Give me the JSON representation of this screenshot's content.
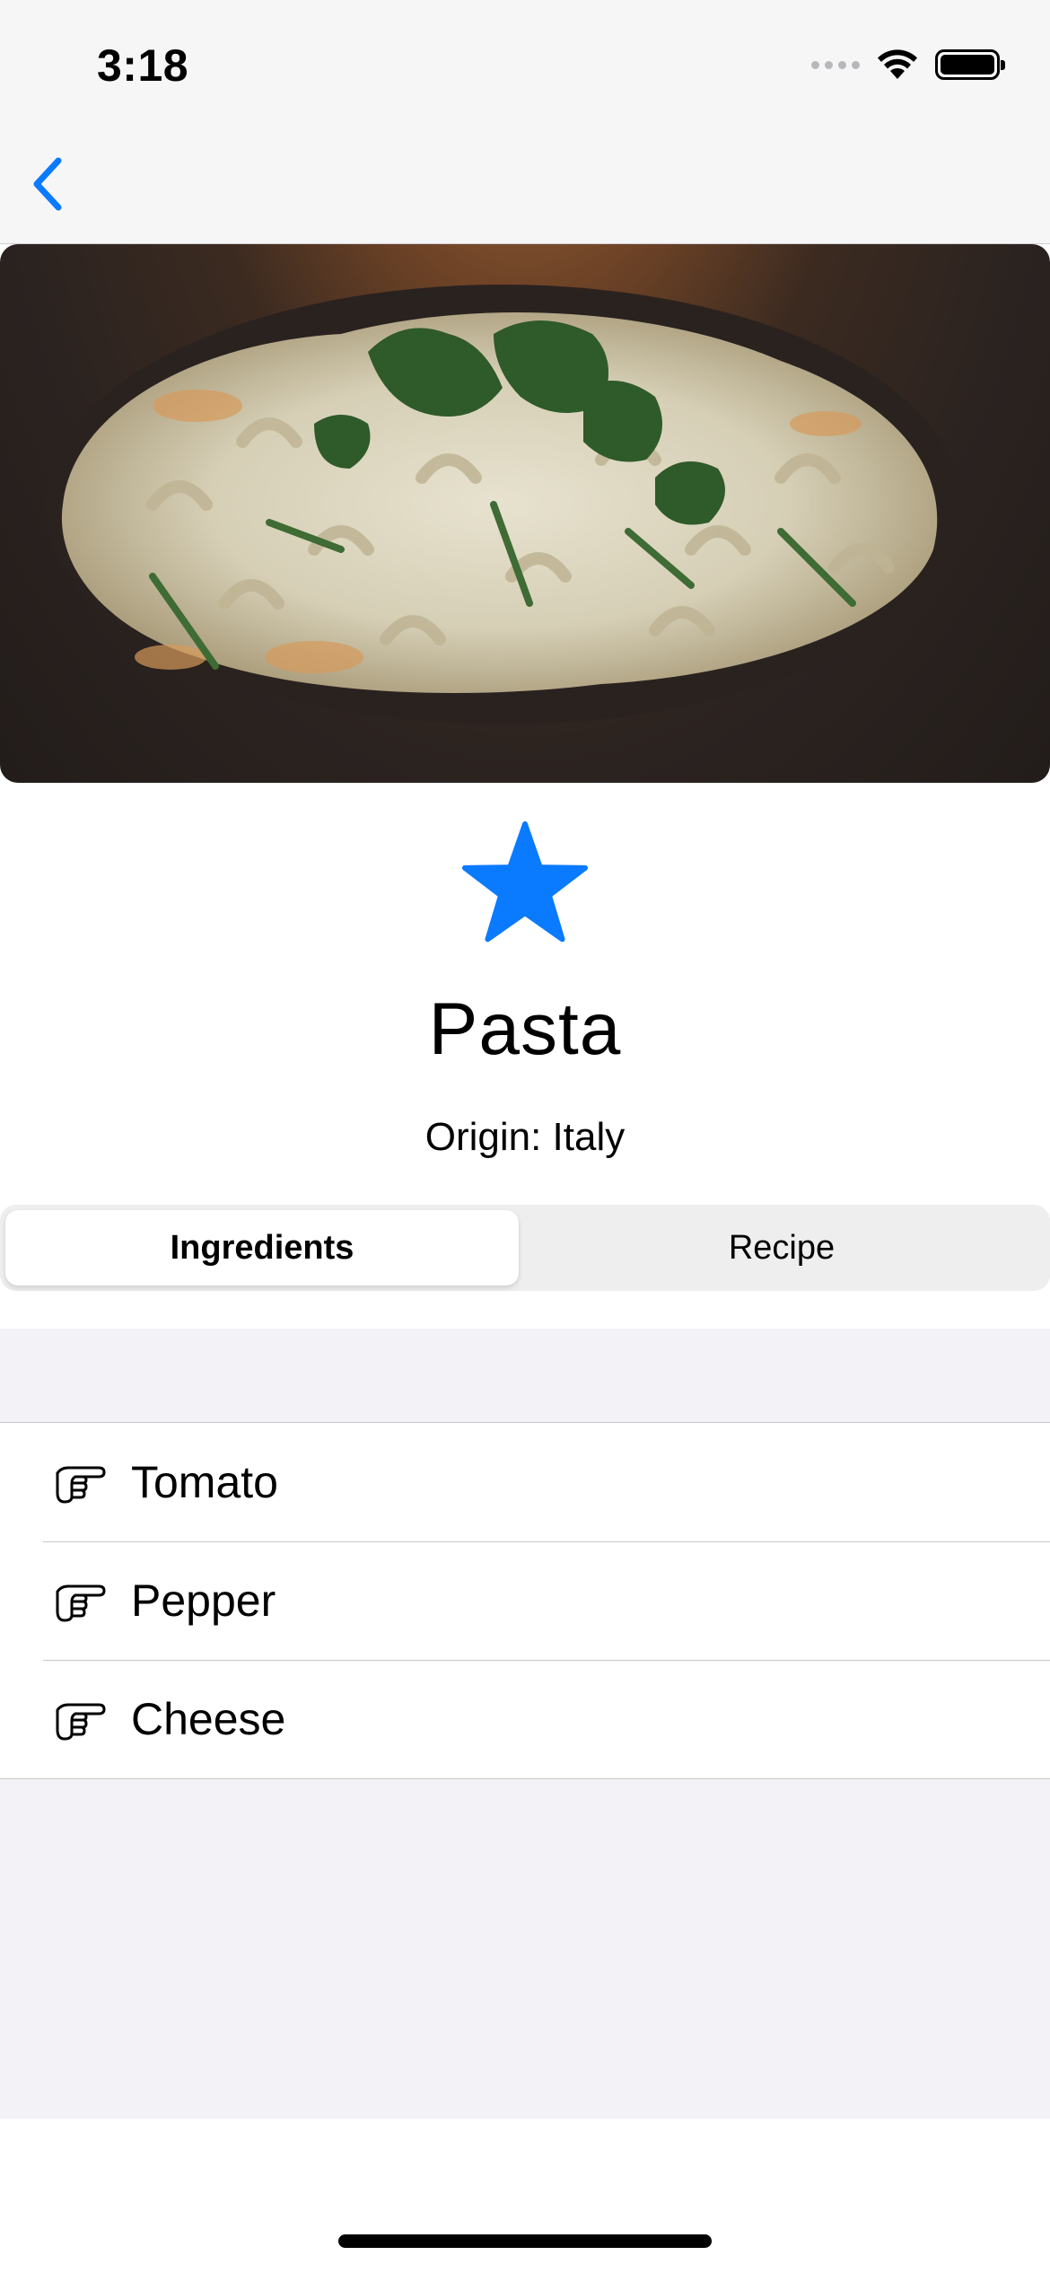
{
  "status_bar": {
    "time": "3:18"
  },
  "nav": {
    "back_icon": "chevron-left-icon"
  },
  "colors": {
    "accent": "#0a7aff",
    "grouped_background": "#f2f2f7"
  },
  "dish": {
    "image_alt": "Pasta dish",
    "favorite_icon": "star-filled-icon",
    "title": "Pasta",
    "origin": "Origin: Italy"
  },
  "segments": [
    {
      "label": "Ingredients",
      "selected": true
    },
    {
      "label": "Recipe",
      "selected": false
    }
  ],
  "ingredients": [
    {
      "icon": "hand-point-right-icon",
      "label": "Tomato"
    },
    {
      "icon": "hand-point-right-icon",
      "label": "Pepper"
    },
    {
      "icon": "hand-point-right-icon",
      "label": "Cheese"
    }
  ]
}
